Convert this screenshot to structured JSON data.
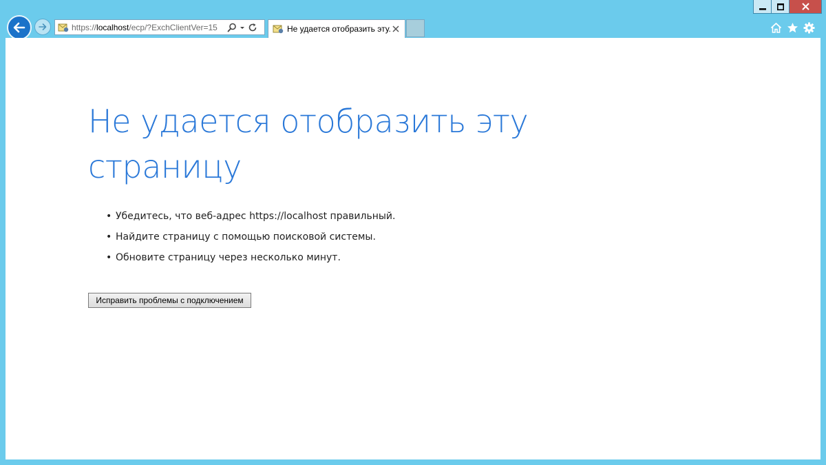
{
  "browser": {
    "address": {
      "prefix": "https://",
      "host": "localhost",
      "path": "/ecp/?ExchClientVer=15"
    },
    "tab": {
      "title": "Не удается отобразить эту..."
    },
    "icons": {
      "back": "arrow-left-icon",
      "forward": "arrow-right-icon",
      "search": "search-icon",
      "dropdown": "chevron-down-icon",
      "refresh": "refresh-icon",
      "close_tab": "close-icon",
      "home": "home-icon",
      "favorites": "star-icon",
      "tools": "gear-icon"
    },
    "colors": {
      "frame": "#6bcbec",
      "back_button": "#1a72c9",
      "heading": "#2a78d8",
      "close_window": "#c7504b"
    }
  },
  "page": {
    "heading": "Не удается отобразить эту страницу",
    "tips": [
      "Убедитесь, что веб-адрес https://localhost правильный.",
      "Найдите страницу с помощью поисковой системы.",
      "Обновите страницу через несколько минут."
    ],
    "fix_button_label": "Исправить проблемы с подключением"
  }
}
